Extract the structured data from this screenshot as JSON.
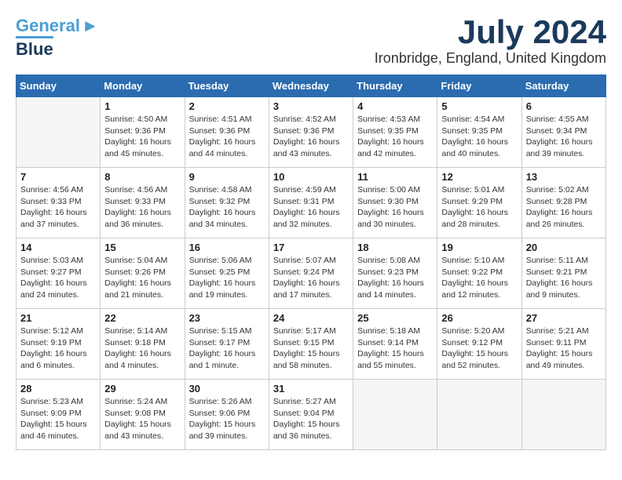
{
  "logo": {
    "line1": "General",
    "line2": "Blue"
  },
  "title": "July 2024",
  "location": "Ironbridge, England, United Kingdom",
  "headers": [
    "Sunday",
    "Monday",
    "Tuesday",
    "Wednesday",
    "Thursday",
    "Friday",
    "Saturday"
  ],
  "weeks": [
    [
      {
        "day": "",
        "info": ""
      },
      {
        "day": "1",
        "info": "Sunrise: 4:50 AM\nSunset: 9:36 PM\nDaylight: 16 hours\nand 45 minutes."
      },
      {
        "day": "2",
        "info": "Sunrise: 4:51 AM\nSunset: 9:36 PM\nDaylight: 16 hours\nand 44 minutes."
      },
      {
        "day": "3",
        "info": "Sunrise: 4:52 AM\nSunset: 9:36 PM\nDaylight: 16 hours\nand 43 minutes."
      },
      {
        "day": "4",
        "info": "Sunrise: 4:53 AM\nSunset: 9:35 PM\nDaylight: 16 hours\nand 42 minutes."
      },
      {
        "day": "5",
        "info": "Sunrise: 4:54 AM\nSunset: 9:35 PM\nDaylight: 16 hours\nand 40 minutes."
      },
      {
        "day": "6",
        "info": "Sunrise: 4:55 AM\nSunset: 9:34 PM\nDaylight: 16 hours\nand 39 minutes."
      }
    ],
    [
      {
        "day": "7",
        "info": "Sunrise: 4:56 AM\nSunset: 9:33 PM\nDaylight: 16 hours\nand 37 minutes."
      },
      {
        "day": "8",
        "info": "Sunrise: 4:56 AM\nSunset: 9:33 PM\nDaylight: 16 hours\nand 36 minutes."
      },
      {
        "day": "9",
        "info": "Sunrise: 4:58 AM\nSunset: 9:32 PM\nDaylight: 16 hours\nand 34 minutes."
      },
      {
        "day": "10",
        "info": "Sunrise: 4:59 AM\nSunset: 9:31 PM\nDaylight: 16 hours\nand 32 minutes."
      },
      {
        "day": "11",
        "info": "Sunrise: 5:00 AM\nSunset: 9:30 PM\nDaylight: 16 hours\nand 30 minutes."
      },
      {
        "day": "12",
        "info": "Sunrise: 5:01 AM\nSunset: 9:29 PM\nDaylight: 16 hours\nand 28 minutes."
      },
      {
        "day": "13",
        "info": "Sunrise: 5:02 AM\nSunset: 9:28 PM\nDaylight: 16 hours\nand 26 minutes."
      }
    ],
    [
      {
        "day": "14",
        "info": "Sunrise: 5:03 AM\nSunset: 9:27 PM\nDaylight: 16 hours\nand 24 minutes."
      },
      {
        "day": "15",
        "info": "Sunrise: 5:04 AM\nSunset: 9:26 PM\nDaylight: 16 hours\nand 21 minutes."
      },
      {
        "day": "16",
        "info": "Sunrise: 5:06 AM\nSunset: 9:25 PM\nDaylight: 16 hours\nand 19 minutes."
      },
      {
        "day": "17",
        "info": "Sunrise: 5:07 AM\nSunset: 9:24 PM\nDaylight: 16 hours\nand 17 minutes."
      },
      {
        "day": "18",
        "info": "Sunrise: 5:08 AM\nSunset: 9:23 PM\nDaylight: 16 hours\nand 14 minutes."
      },
      {
        "day": "19",
        "info": "Sunrise: 5:10 AM\nSunset: 9:22 PM\nDaylight: 16 hours\nand 12 minutes."
      },
      {
        "day": "20",
        "info": "Sunrise: 5:11 AM\nSunset: 9:21 PM\nDaylight: 16 hours\nand 9 minutes."
      }
    ],
    [
      {
        "day": "21",
        "info": "Sunrise: 5:12 AM\nSunset: 9:19 PM\nDaylight: 16 hours\nand 6 minutes."
      },
      {
        "day": "22",
        "info": "Sunrise: 5:14 AM\nSunset: 9:18 PM\nDaylight: 16 hours\nand 4 minutes."
      },
      {
        "day": "23",
        "info": "Sunrise: 5:15 AM\nSunset: 9:17 PM\nDaylight: 16 hours\nand 1 minute."
      },
      {
        "day": "24",
        "info": "Sunrise: 5:17 AM\nSunset: 9:15 PM\nDaylight: 15 hours\nand 58 minutes."
      },
      {
        "day": "25",
        "info": "Sunrise: 5:18 AM\nSunset: 9:14 PM\nDaylight: 15 hours\nand 55 minutes."
      },
      {
        "day": "26",
        "info": "Sunrise: 5:20 AM\nSunset: 9:12 PM\nDaylight: 15 hours\nand 52 minutes."
      },
      {
        "day": "27",
        "info": "Sunrise: 5:21 AM\nSunset: 9:11 PM\nDaylight: 15 hours\nand 49 minutes."
      }
    ],
    [
      {
        "day": "28",
        "info": "Sunrise: 5:23 AM\nSunset: 9:09 PM\nDaylight: 15 hours\nand 46 minutes."
      },
      {
        "day": "29",
        "info": "Sunrise: 5:24 AM\nSunset: 9:08 PM\nDaylight: 15 hours\nand 43 minutes."
      },
      {
        "day": "30",
        "info": "Sunrise: 5:26 AM\nSunset: 9:06 PM\nDaylight: 15 hours\nand 39 minutes."
      },
      {
        "day": "31",
        "info": "Sunrise: 5:27 AM\nSunset: 9:04 PM\nDaylight: 15 hours\nand 36 minutes."
      },
      {
        "day": "",
        "info": ""
      },
      {
        "day": "",
        "info": ""
      },
      {
        "day": "",
        "info": ""
      }
    ]
  ]
}
